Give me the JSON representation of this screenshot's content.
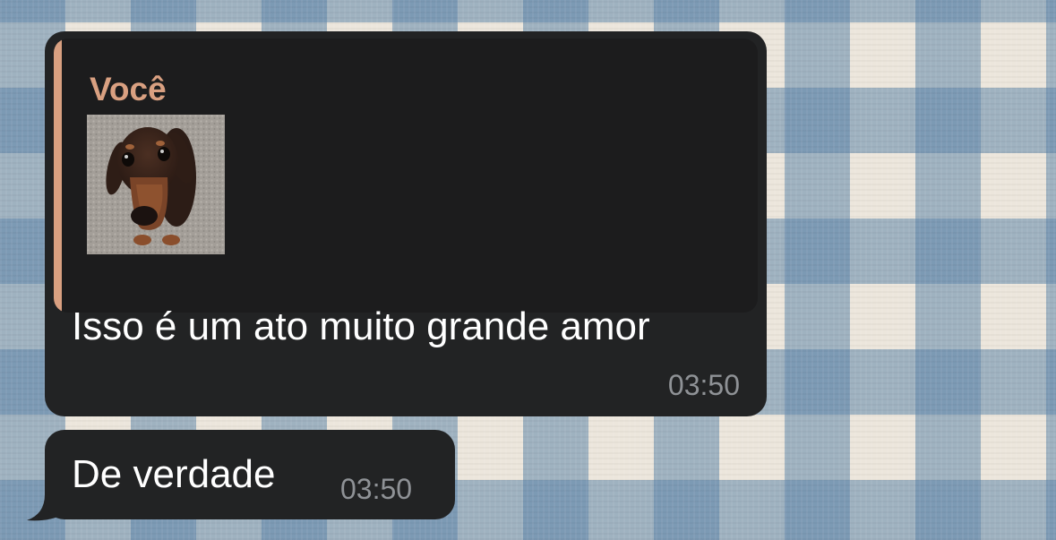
{
  "conversation": {
    "messages": [
      {
        "reply": {
          "author": "Você",
          "attachment_icon": "dachshund-photo"
        },
        "text": "Isso é um ato muito grande amor",
        "time": "03:50"
      },
      {
        "text": "De verdade",
        "time": "03:50"
      }
    ]
  },
  "colors": {
    "bubble": "#222324",
    "quote_background": "#1c1c1d",
    "quote_accent": "#d9a081",
    "timestamp": "#8f9296",
    "wallpaper_light": "#ece6dc",
    "wallpaper_blue": "#6086aa"
  }
}
